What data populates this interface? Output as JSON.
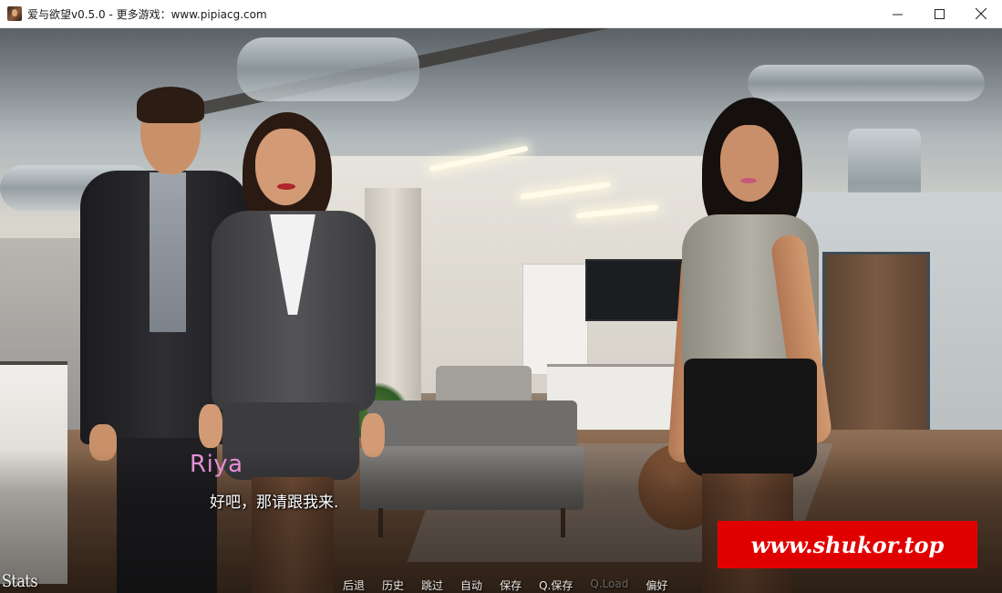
{
  "window": {
    "title": "爱与欲望v0.5.0 - 更多游戏：www.pipiacg.com",
    "controls": {
      "minimize": "—",
      "maximize": "☐",
      "close": "✕"
    }
  },
  "dialogue": {
    "speaker": "Riya",
    "text": "好吧，那请跟我来.",
    "speaker_color": "#e48ed6"
  },
  "watermark": {
    "text": "www.shukor.top",
    "color": "#e10000"
  },
  "hud": {
    "stats_label": "Stats"
  },
  "quick_menu": [
    {
      "label": "后退",
      "enabled": true
    },
    {
      "label": "历史",
      "enabled": true
    },
    {
      "label": "跳过",
      "enabled": true
    },
    {
      "label": "自动",
      "enabled": true
    },
    {
      "label": "保存",
      "enabled": true
    },
    {
      "label": "Q.保存",
      "enabled": true
    },
    {
      "label": "Q.Load",
      "enabled": false
    },
    {
      "label": "偏好",
      "enabled": true
    }
  ]
}
